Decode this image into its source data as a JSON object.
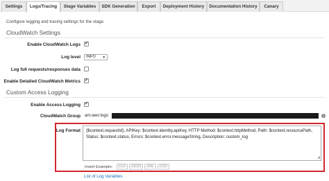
{
  "tabs": [
    {
      "label": "Settings",
      "active": false
    },
    {
      "label": "Logs/Tracing",
      "active": true
    },
    {
      "label": "Stage Variables",
      "active": false
    },
    {
      "label": "SDK Generation",
      "active": false
    },
    {
      "label": "Export",
      "active": false
    },
    {
      "label": "Deployment History",
      "active": false
    },
    {
      "label": "Documentation History",
      "active": false
    },
    {
      "label": "Canary",
      "active": false
    }
  ],
  "help_text": "Configure logging and tracing settings for the stage.",
  "cloudwatch": {
    "title": "CloudWatch Settings",
    "enable_logs": {
      "label": "Enable CloudWatch Logs",
      "checked": true
    },
    "log_level": {
      "label": "Log level",
      "value": "INFO"
    },
    "log_full": {
      "label": "Log full requests/responses data",
      "checked": false
    },
    "detailed_metrics": {
      "label": "Enable Detailed CloudWatch Metrics",
      "checked": true
    }
  },
  "access_logging": {
    "title": "Custom Access Logging",
    "enable": {
      "label": "Enable Access Logging",
      "checked": true
    },
    "group": {
      "label": "CloudWatch Group",
      "value": "arn:aws:logs:"
    },
    "format": {
      "label": "Log Format",
      "value": "{$context.requestId}, APIKey: $context.identity.apiKey, HTTP Method: $context.httpMethod, Path: $context.resourcePath, Status: $context.status, Errors: $context.error.messageString, Description: custom_log"
    },
    "insert_example": {
      "label": "Insert Example:",
      "formats": [
        "CLF",
        "JSON",
        "XML",
        "CSV"
      ]
    },
    "variables_link": "List of Log Variables"
  },
  "colors": {
    "highlight": "#d0262c",
    "link": "#1a6fb3"
  },
  "icons": {
    "checkmark": "✔",
    "info": "i"
  }
}
